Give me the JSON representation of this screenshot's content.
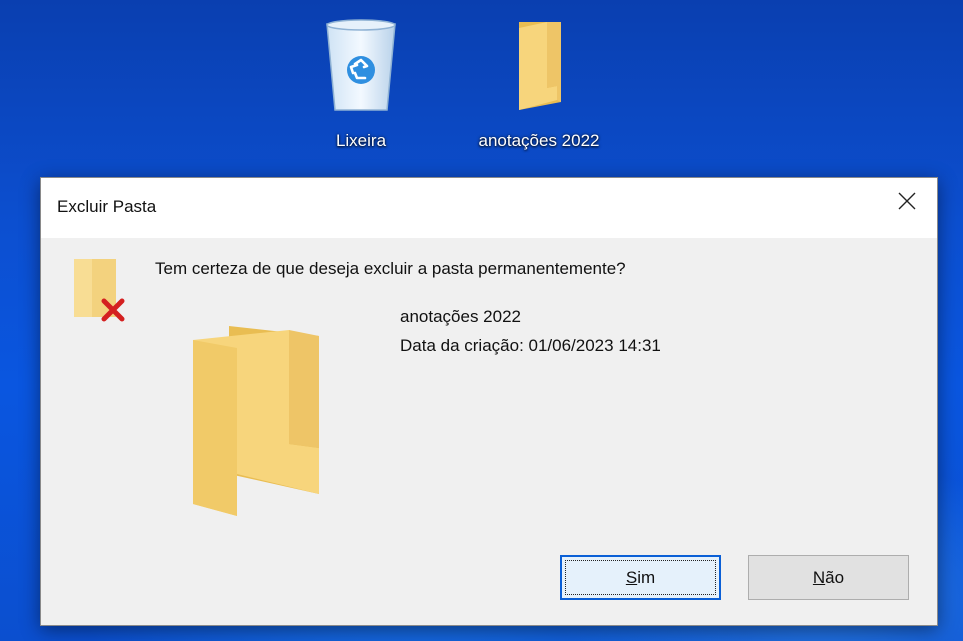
{
  "desktop": {
    "icons": [
      {
        "label": "Lixeira",
        "icon": "recycle-bin-icon"
      },
      {
        "label": "anotações 2022",
        "icon": "folder-icon"
      }
    ]
  },
  "dialog": {
    "title": "Excluir Pasta",
    "close_icon": "close-icon",
    "question": "Tem certeza de que deseja excluir a pasta permanentemente?",
    "item": {
      "name": "anotações 2022",
      "date_label": "Data da criação: 01/06/2023 14:31"
    },
    "buttons": {
      "yes": {
        "accel": "S",
        "rest": "im",
        "full": "Sim"
      },
      "no": {
        "accel": "N",
        "rest": "ão",
        "full": "Não"
      }
    }
  },
  "colors": {
    "desktop_bg": "#0b4fcf",
    "dialog_bg": "#f0f0f0",
    "titlebar_bg": "#ffffff",
    "default_button_border": "#0a5fd6",
    "folder_yellow": "#f5d27a",
    "delete_x": "#d42020"
  }
}
